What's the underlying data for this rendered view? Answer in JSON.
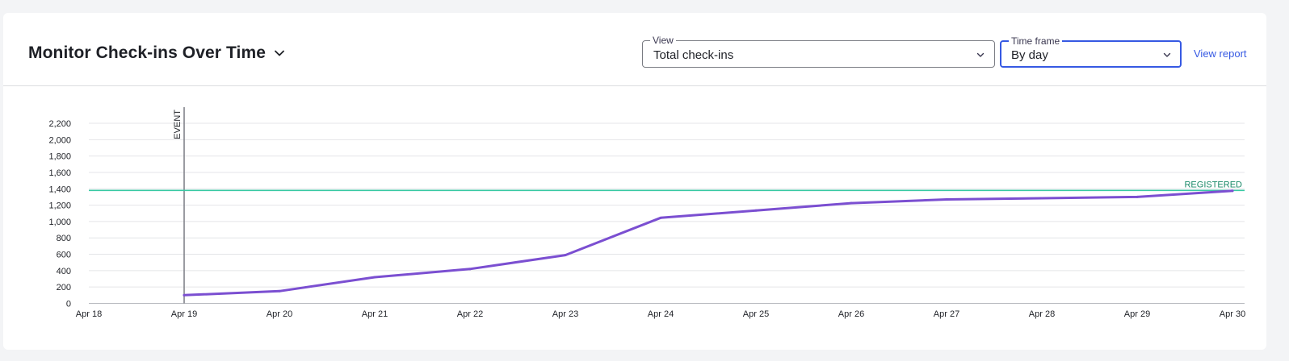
{
  "header": {
    "title": "Monitor Check-ins Over Time",
    "title_icon": "chevron-down-icon",
    "view_field": {
      "label": "View",
      "value": "Total check-ins",
      "icon": "chevron-down-icon"
    },
    "timeframe_field": {
      "label": "Time frame",
      "value": "By day",
      "icon": "chevron-down-icon"
    },
    "view_report_label": "View report"
  },
  "colors": {
    "series": "#7b4fd1",
    "registered": "#38c9a3",
    "registered_label": "#1c8a6a",
    "event": "#7a7c83",
    "grid": "#e4e5e8",
    "accent": "#3659e3"
  },
  "chart_data": {
    "type": "line",
    "x": [
      "Apr 18",
      "Apr 19",
      "Apr 20",
      "Apr 21",
      "Apr 22",
      "Apr 23",
      "Apr 24",
      "Apr 25",
      "Apr 26",
      "Apr 27",
      "Apr 28",
      "Apr 29",
      "Apr 30"
    ],
    "series": [
      {
        "values": [
          null,
          100,
          150,
          320,
          420,
          590,
          1045,
          1135,
          1225,
          1270,
          1285,
          1300,
          1375
        ]
      }
    ],
    "yticks": [
      0,
      200,
      400,
      600,
      800,
      1000,
      1200,
      1400,
      1600,
      1800,
      2000,
      2200
    ],
    "ytick_labels": [
      "0",
      "200",
      "400",
      "600",
      "800",
      "1,000",
      "1,200",
      "1,400",
      "1,600",
      "1,800",
      "2,000",
      "2,200"
    ],
    "ylim": [
      0,
      2350
    ],
    "grid": true,
    "annotations": [
      {
        "type": "vertical-line",
        "x": "Apr 19",
        "label": "EVENT"
      },
      {
        "type": "horizontal-line",
        "y": 1380,
        "label": "REGISTERED"
      }
    ]
  }
}
